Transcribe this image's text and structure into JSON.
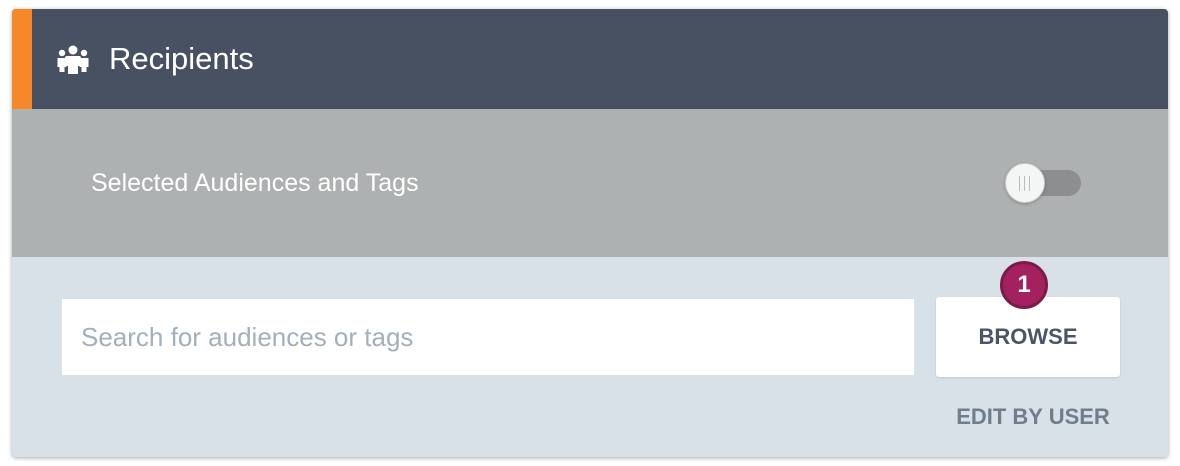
{
  "header": {
    "title": "Recipients",
    "icon": "group-icon",
    "background": "#475162",
    "accent_color": "#f5892a"
  },
  "toggle_row": {
    "label": "Selected Audiences and Tags",
    "toggle_on": false
  },
  "search": {
    "placeholder": "Search for audiences or tags",
    "value": ""
  },
  "browse": {
    "label": "BROWSE",
    "badge": "1",
    "badge_color": "#a3215f"
  },
  "edit_by_user": {
    "label": "EDIT BY USER"
  }
}
